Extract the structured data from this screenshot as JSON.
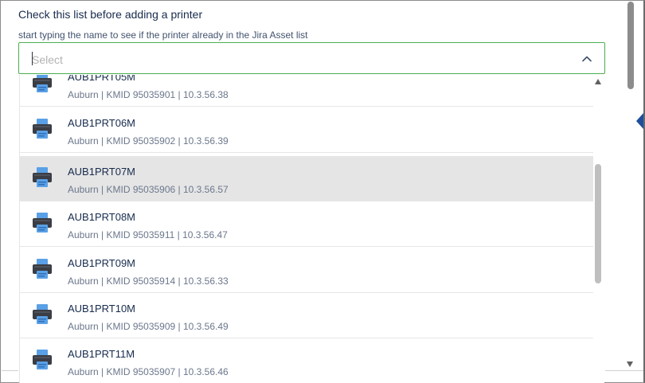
{
  "form": {
    "title": "Check this list before adding a printer",
    "hint": "start typing the name to see if the printer already in the Jira Asset list"
  },
  "select": {
    "placeholder": "Select",
    "icon": "chevron-up-icon"
  },
  "options": [
    {
      "name": "AUB1PRT05M",
      "detail": "Auburn | KMID 95035901 | 10.3.56.38",
      "icon": "printer-icon"
    },
    {
      "name": "AUB1PRT06M",
      "detail": "Auburn | KMID 95035902 | 10.3.56.39",
      "icon": "printer-icon"
    },
    {
      "name": "AUB1PRT07M",
      "detail": "Auburn | KMID 95035906 | 10.3.56.57",
      "icon": "printer-icon",
      "highlighted": true
    },
    {
      "name": "AUB1PRT08M",
      "detail": "Auburn | KMID 95035911 | 10.3.56.47",
      "icon": "printer-icon"
    },
    {
      "name": "AUB1PRT09M",
      "detail": "Auburn | KMID 95035914 | 10.3.56.33",
      "icon": "printer-icon"
    },
    {
      "name": "AUB1PRT10M",
      "detail": "Auburn | KMID 95035909 | 10.3.56.49",
      "icon": "printer-icon"
    },
    {
      "name": "AUB1PRT11M",
      "detail": "Auburn | KMID 95035907 | 10.3.56.46",
      "icon": "printer-icon"
    }
  ],
  "colors": {
    "focus_border": "#4caf50",
    "highlight_row": "#e5e5e5",
    "side_arrow": "#1f4e9c"
  }
}
